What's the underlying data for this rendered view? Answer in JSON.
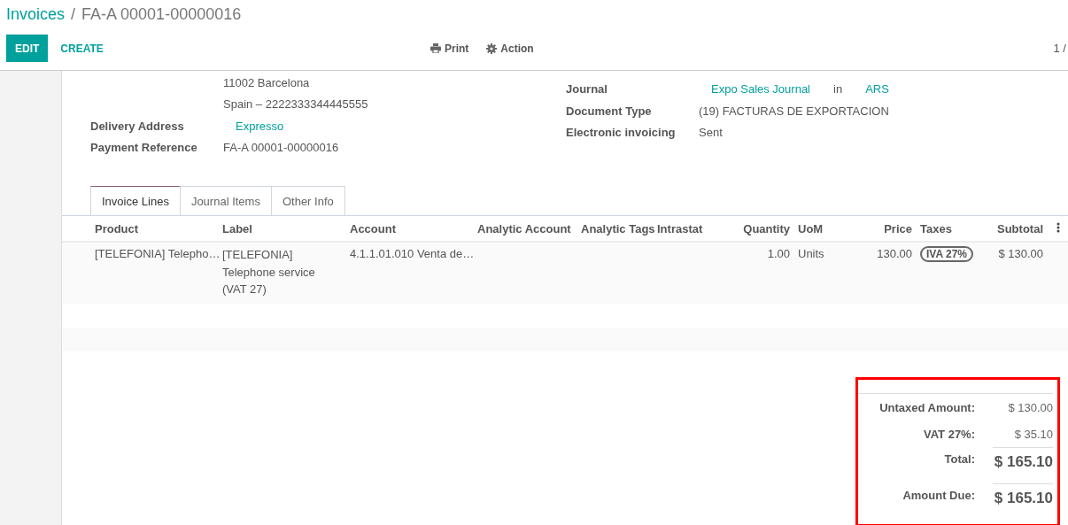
{
  "breadcrumb": {
    "parent": "Invoices",
    "separator": "/",
    "current": "FA-A 00001-00000016"
  },
  "buttons": [
    {
      "label": "EDIT",
      "kind": "primary"
    },
    {
      "label": "CREATE",
      "kind": "link"
    }
  ],
  "actions": [
    {
      "label": "Print",
      "kind": "print"
    },
    {
      "label": "Action",
      "kind": "gear"
    }
  ],
  "pager": "1 /",
  "address_lines": [
    "11002 Barcelona",
    "Spain – 2222333344445555"
  ],
  "left_fields": [
    {
      "label": "Delivery Address",
      "parts": [
        {
          "text": "Expresso",
          "link": true
        }
      ]
    },
    {
      "label": "Payment Reference",
      "parts": [
        {
          "text": "FA-A 00001-00000016",
          "link": false
        }
      ]
    }
  ],
  "right_fields": [
    {
      "label": "Journal",
      "parts": [
        {
          "text": "Expo Sales Journal",
          "link": true
        },
        {
          "text": "in",
          "link": false
        },
        {
          "text": "ARS",
          "link": true
        }
      ]
    },
    {
      "label": "Document Type",
      "parts": [
        {
          "text": "(19) FACTURAS DE EXPORTACION",
          "link": false
        }
      ]
    },
    {
      "label": "Electronic invoicing",
      "parts": [
        {
          "text": "Sent",
          "link": false
        }
      ]
    }
  ],
  "tabs": [
    {
      "label": "Invoice Lines",
      "selected": true
    },
    {
      "label": "Journal Items",
      "selected": false
    },
    {
      "label": "Other Info",
      "selected": false
    }
  ],
  "table": {
    "columns": [
      {
        "label": "Product",
        "kind": "text"
      },
      {
        "label": "Label",
        "kind": "wrap"
      },
      {
        "label": "Account",
        "kind": "text"
      },
      {
        "label": "Analytic Account",
        "kind": "text"
      },
      {
        "label": "Analytic Tags",
        "kind": "text"
      },
      {
        "label": "Intrastat",
        "kind": "text"
      },
      {
        "label": "Quantity",
        "kind": "number"
      },
      {
        "label": "UoM",
        "kind": "text"
      },
      {
        "label": "Price",
        "kind": "number"
      },
      {
        "label": "Taxes",
        "kind": "tags"
      },
      {
        "label": "Subtotal",
        "kind": "number"
      }
    ],
    "rows": [
      {
        "cells": [
          "[TELEFONIA] Telepho…",
          "[TELEFONIA] Telephone service (VAT 27)",
          "4.1.1.01.010 Venta de…",
          null,
          null,
          null,
          "1.00",
          "Units",
          "130.00",
          [
            "IVA 27%"
          ],
          "$ 130.00"
        ]
      }
    ]
  },
  "totals": {
    "highlighted": true,
    "lines": [
      {
        "label": "Untaxed Amount:",
        "value": "$ 130.00",
        "kind": "plain"
      },
      {
        "label": "VAT 27%:",
        "value": "$ 35.10",
        "kind": "plain"
      },
      {
        "label": "Total:",
        "value": "$ 165.10",
        "kind": "grand"
      },
      {
        "label": "Amount Due:",
        "value": "$ 165.10",
        "kind": "grand"
      }
    ]
  }
}
